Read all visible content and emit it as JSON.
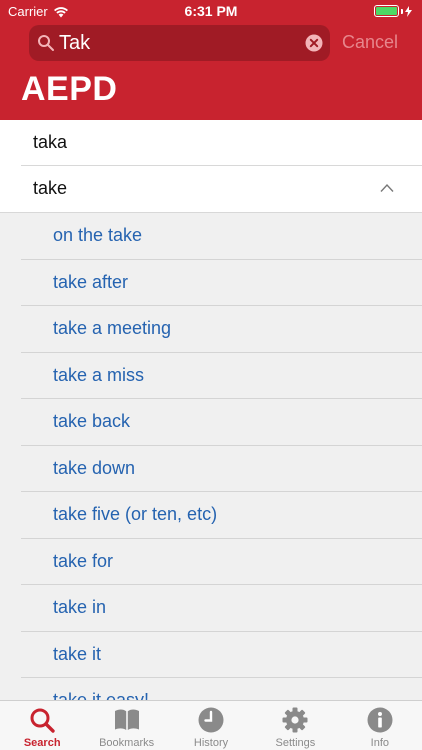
{
  "status_bar": {
    "carrier": "Carrier",
    "time": "6:31 PM"
  },
  "search": {
    "value": "Tak",
    "placeholder": "",
    "cancel_label": "Cancel"
  },
  "app": {
    "title": "AEPD"
  },
  "results": [
    {
      "label": "taka",
      "expanded": false
    },
    {
      "label": "take",
      "expanded": true
    }
  ],
  "sub_entries": [
    "on the take",
    "take after",
    "take a meeting",
    "take a miss",
    "take back",
    "take down",
    "take five (or ten, etc)",
    "take for",
    "take in",
    "take it",
    "take it easy!"
  ],
  "tabs": [
    {
      "label": "Search",
      "icon": "search-icon",
      "active": true
    },
    {
      "label": "Bookmarks",
      "icon": "book-icon",
      "active": false
    },
    {
      "label": "History",
      "icon": "clock-icon",
      "active": false
    },
    {
      "label": "Settings",
      "icon": "gear-icon",
      "active": false
    },
    {
      "label": "Info",
      "icon": "info-icon",
      "active": false
    }
  ],
  "colors": {
    "accent": "#c8232f",
    "link": "#2563b0",
    "tab_inactive": "#8a8a8a"
  }
}
